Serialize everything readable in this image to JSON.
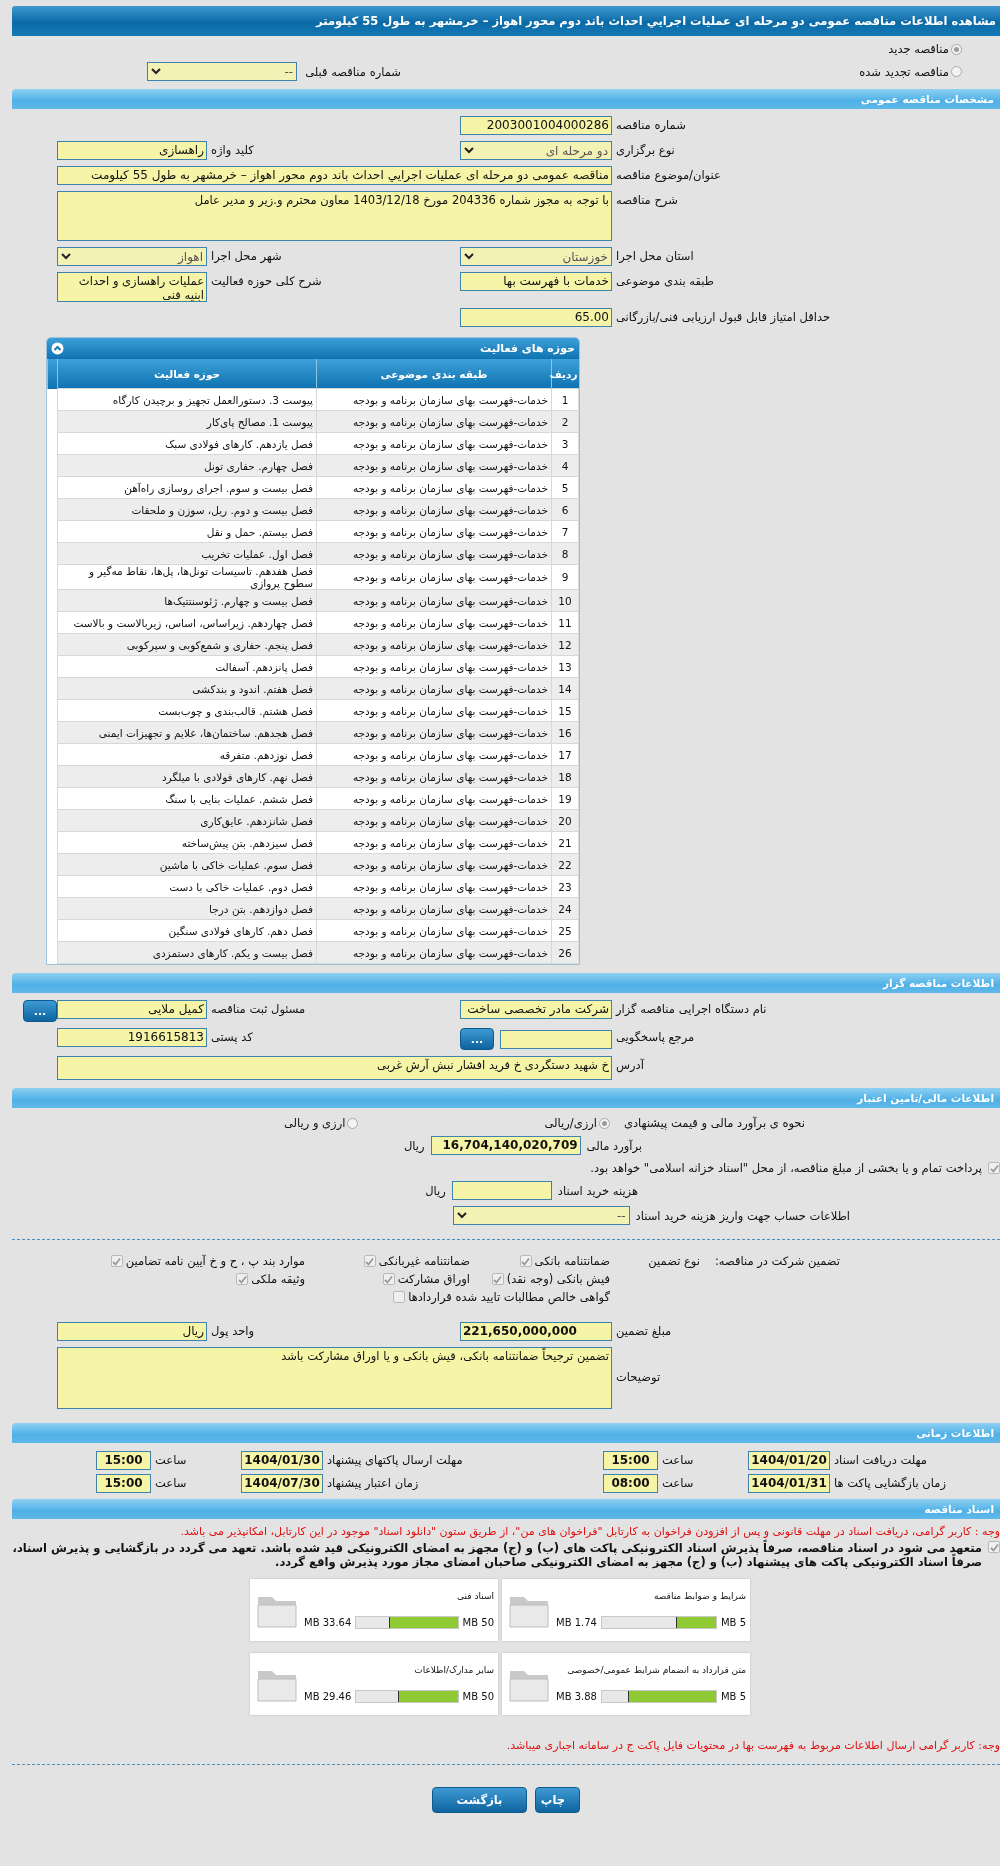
{
  "title": "مشاهده اطلاعات مناقصه عمومی دو مرحله ای عملیات اجرایي احداث باند دوم محور اهواز – خرمشهر به طول 55 کیلومتر",
  "tender_kind": [
    {
      "label": "مناقصه جدید",
      "selected": true
    },
    {
      "label": "مناقصه تجدید شده",
      "selected": false
    }
  ],
  "previous_tender": {
    "label": "شماره مناقصه قبلی",
    "value": "--"
  },
  "general": {
    "header": "مشخصات مناقصه عمومی",
    "rows": [
      {
        "right": {
          "label": "شماره مناقصه",
          "value": "2003001004000286",
          "kind": "text"
        }
      },
      {
        "right": {
          "label": "نوع برگزاری",
          "value": "دو مرحله ای",
          "kind": "select"
        },
        "left": {
          "label": "کلید واژه",
          "value": "راهسازی",
          "kind": "text"
        }
      },
      {
        "right": {
          "label": "عنوان/موضوع مناقصه",
          "value": "مناقصه عمومی دو مرحله ای عملیات اجرایي احداث باند دوم محور اهواز – خرمشهر به طول 55 کیلومت",
          "kind": "wide"
        }
      },
      {
        "right": {
          "label": "شرح مناقصه",
          "value": "با توجه به مجوز شماره 204336 مورخ 1403/12/18 معاون محترم و.زیر و مدیر عامل",
          "kind": "wide_textarea"
        }
      },
      {
        "right": {
          "label": "استان محل اجرا",
          "value": "خوزستان",
          "kind": "select"
        },
        "left": {
          "label": "شهر محل اجرا",
          "value": "اهواز",
          "kind": "select"
        }
      },
      {
        "right": {
          "label": "طبقه بندی موضوعی",
          "value": "خدمات با فهرست بها",
          "kind": "text"
        },
        "left": {
          "label": "شرح کلی حوزه فعالیت",
          "value": "عملیات راهسازی و احداث ابنیه فنی",
          "kind": "textarea"
        }
      },
      {
        "right": {
          "label": "حداقل امتیاز قابل قبول ارزیابی فنی/بازرگانی",
          "value": "65.00",
          "kind": "text"
        }
      }
    ]
  },
  "activities": {
    "header": "حوزه های فعالیت",
    "expanded": true,
    "columns": [
      "ردیف",
      "طبقه بندی موضوعی",
      "حوزه فعالیت"
    ],
    "rows": [
      {
        "n": "1",
        "category": "خدمات-فهرست بهای سازمان برنامه و بودجه",
        "area": "پیوست 3. دستورالعمل تجهیز و برچیدن کارگاه"
      },
      {
        "n": "2",
        "category": "خدمات-فهرست بهای سازمان برنامه و بودجه",
        "area": "پیوست 1. مصالح پای‌کار"
      },
      {
        "n": "3",
        "category": "خدمات-فهرست بهای سازمان برنامه و بودجه",
        "area": "فصل یازدهم. کارهای فولادی سبک"
      },
      {
        "n": "4",
        "category": "خدمات-فهرست بهای سازمان برنامه و بودجه",
        "area": "فصل چهارم. حفاری تونل"
      },
      {
        "n": "5",
        "category": "خدمات-فهرست بهای سازمان برنامه و بودجه",
        "area": "فصل بیست و سوم. اجرای روسازی راه‌آهن"
      },
      {
        "n": "6",
        "category": "خدمات-فهرست بهای سازمان برنامه و بودجه",
        "area": "فصل بیست و دوم. ریل، سوزن و ملحقات"
      },
      {
        "n": "7",
        "category": "خدمات-فهرست بهای سازمان برنامه و بودجه",
        "area": "فصل بیستم. حمل و نقل"
      },
      {
        "n": "8",
        "category": "خدمات-فهرست بهای سازمان برنامه و بودجه",
        "area": "فصل اول. عملیات تخریب"
      },
      {
        "n": "9",
        "category": "خدمات-فهرست بهای سازمان برنامه و بودجه",
        "area": "فصل هفدهم. تاسیسات تونل‌ها، پل‌ها، نقاط مه‌گیر و سطوح پروازی"
      },
      {
        "n": "10",
        "category": "خدمات-فهرست بهای سازمان برنامه و بودجه",
        "area": "فصل بیست و چهارم. ژئوسنتتیک‌ها"
      },
      {
        "n": "11",
        "category": "خدمات-فهرست بهای سازمان برنامه و بودجه",
        "area": "فصل چهاردهم. زیراساس، اساس، زیربالاست  و بالاست"
      },
      {
        "n": "12",
        "category": "خدمات-فهرست بهای سازمان برنامه و بودجه",
        "area": "فصل پنجم. حفاری و شمع‌کوبی و سپرکوبی"
      },
      {
        "n": "13",
        "category": "خدمات-فهرست بهای سازمان برنامه و بودجه",
        "area": "فصل پانزدهم. آسفالت"
      },
      {
        "n": "14",
        "category": "خدمات-فهرست بهای سازمان برنامه و بودجه",
        "area": "فصل هفتم. اندود و بندکشی"
      },
      {
        "n": "15",
        "category": "خدمات-فهرست بهای سازمان برنامه و بودجه",
        "area": "فصل هشتم. قالب‌بندی و چوب‌بست"
      },
      {
        "n": "16",
        "category": "خدمات-فهرست بهای سازمان برنامه و بودجه",
        "area": "فصل هجدهم. ساختمان‌ها، علایم و تجهیزات ایمنی"
      },
      {
        "n": "17",
        "category": "خدمات-فهرست بهای سازمان برنامه و بودجه",
        "area": "فصل نوزدهم. متفرقه"
      },
      {
        "n": "18",
        "category": "خدمات-فهرست بهای سازمان برنامه و بودجه",
        "area": "فصل نهم. کارهای فولادی با میلگرد"
      },
      {
        "n": "19",
        "category": "خدمات-فهرست بهای سازمان برنامه و بودجه",
        "area": "فصل ششم. عملیات بنایی با سنگ"
      },
      {
        "n": "20",
        "category": "خدمات-فهرست بهای سازمان برنامه و بودجه",
        "area": "فصل شانزدهم. عایق‌کاری"
      },
      {
        "n": "21",
        "category": "خدمات-فهرست بهای سازمان برنامه و بودجه",
        "area": "فصل سیزدهم. بتن پیش‌ساخته"
      },
      {
        "n": "22",
        "category": "خدمات-فهرست بهای سازمان برنامه و بودجه",
        "area": "فصل سوم. عملیات خاکی با ماشین"
      },
      {
        "n": "23",
        "category": "خدمات-فهرست بهای سازمان برنامه و بودجه",
        "area": "فصل دوم. عملیات خاکی با دست"
      },
      {
        "n": "24",
        "category": "خدمات-فهرست بهای سازمان برنامه و بودجه",
        "area": "فصل دوازدهم. بتن درجا"
      },
      {
        "n": "25",
        "category": "خدمات-فهرست بهای سازمان برنامه و بودجه",
        "area": "فصل دهم. کارهای فولادی سنگین"
      },
      {
        "n": "26",
        "category": "خدمات-فهرست بهای سازمان برنامه و بودجه",
        "area": "فصل بیست و یکم. کارهای دستمزدی"
      }
    ]
  },
  "organizer": {
    "header": "اطلاعات مناقصه گزار",
    "rows": [
      {
        "right": {
          "label": "نام دستگاه اجرایی مناقصه گزار",
          "value": "شرکت مادر تخصصی ساخت",
          "kind": "text"
        },
        "left": {
          "label": "مسئول ثبت مناقصه",
          "value": "کمیل ملایی",
          "kind": "text",
          "button": "..."
        }
      },
      {
        "right": {
          "label": "مرجع پاسخگویی",
          "kind": "text",
          "button": "..."
        },
        "left": {
          "label": "کد پستی",
          "value": "1916615813",
          "kind": "text"
        }
      },
      {
        "right": {
          "label": "آدرس",
          "value": "خ شهید دستگردی خ فرید افشار نبش آرش غربی",
          "kind": "wide_textarea"
        }
      }
    ]
  },
  "finance": {
    "header": "اطلاعات مالی/تامین اعتبار",
    "estimate_method": {
      "label": "نحوه ی برآورد مالی و قیمت پیشنهادی",
      "options": [
        {
          "label": "ارزی/ریالی",
          "selected": true
        },
        {
          "label": "ارزی و ریالی",
          "selected": false
        }
      ]
    },
    "estimate": {
      "label": "برآورد مالی",
      "value": "16,704,140,020,709",
      "unit": "ریال"
    },
    "treasury": {
      "label": "پرداخت تمام و یا بخشی از مبلغ مناقصه، از محل \"اسناد خزانه اسلامی\" خواهد بود.",
      "checked": true
    },
    "doc_fee": {
      "label": "هزینه خرید اسناد",
      "unit": "ریال"
    },
    "account": {
      "label": "اطلاعات حساب جهت واریز هزینه خرید اسناد",
      "value": "--"
    }
  },
  "guarantee": {
    "label": "تضمین شرکت در مناقصه:",
    "type_label": "نوع تضمین",
    "options": [
      {
        "label": "ضمانتنامه بانکی",
        "checked": true
      },
      {
        "label": "ضمانتنامه غیربانکی",
        "checked": true
      },
      {
        "label": "موارد بند پ ، ح و خ آیین نامه تضامین",
        "checked": true
      },
      {
        "label": "فیش بانکی (وجه نقد)",
        "checked": true
      },
      {
        "label": "اوراق مشارکت",
        "checked": true
      },
      {
        "label": "وثیقه ملکی",
        "checked": true
      },
      {
        "label": "گواهی خالص مطالبات تایید شده قراردادها",
        "checked": false
      }
    ],
    "amount": {
      "label": "مبلغ تضمین",
      "value": "221,650,000,000"
    },
    "currency": {
      "label": "واحد پول",
      "value": "ریال"
    },
    "notes": {
      "label": "توضیحات",
      "value": "تضمین ترجیحاً ضمانتنامه بانکی، فیش بانکی و یا اوراق مشارکت باشد"
    }
  },
  "timing": {
    "header": "اطلاعات زمانی",
    "rows": [
      [
        {
          "label": "مهلت دریافت اسناد",
          "value": "1404/01/20"
        },
        {
          "label": "ساعت",
          "value": "15:00"
        },
        {
          "label": "مهلت ارسال پاکتهای پیشنهاد",
          "value": "1404/01/30"
        },
        {
          "label": "ساعت",
          "value": "15:00"
        }
      ],
      [
        {
          "label": "زمان بازگشایی پاکت ها",
          "value": "1404/01/31"
        },
        {
          "label": "ساعت",
          "value": "08:00"
        },
        {
          "label": "زمان اعتبار پیشنهاد",
          "value": "1404/07/30"
        },
        {
          "label": "ساعت",
          "value": "15:00"
        }
      ]
    ]
  },
  "documents": {
    "header": "اسناد مناقصه",
    "notice": "وجه : کاربر گرامی، دریافت اسناد در مهلت قانونی و پس از افزودن فراخوان به کارتابل \"فراخوان های من\"، از طریق ستون \"دانلود اسناد\" موجود در این کارتابل، امکانپذیر می باشد.",
    "commitment": {
      "text": "متعهد می شود در اسناد مناقصه، صرفاً پذیرش اسناد الکترونیکی پاکت های (ب) و (ج) مجهز به امضای الکترونیکی قید شده باشد. تعهد می گردد در بازگشایی و پذیرش اسناد، صرفاً اسناد الکترونیکی پاکت های پیشنهاد (ب) و (ج) مجهز به امضای الکترونیکی صاحبان امضای مجاز مورد پذیرش واقع گردد.",
      "checked": true
    },
    "files": [
      {
        "name": "شرایط و ضوابط مناقصه",
        "max": "5 MB",
        "used": "1.74 MB",
        "level": 0.348
      },
      {
        "name": "اسناد فنی",
        "max": "50 MB",
        "used": "33.64 MB",
        "level": 0.673
      },
      {
        "name": "متن قرارداد به انضمام شرایط عمومی/خصوصی",
        "max": "5 MB",
        "used": "3.88 MB",
        "level": 0.776
      },
      {
        "name": "سایر مدارک/اطلاعات",
        "max": "50 MB",
        "used": "29.46 MB",
        "level": 0.589
      }
    ],
    "footer_notice": "وجه: کاربر گرامی ارسال اطلاعات مربوط به فهرست بها در محتویات فایل پاکت ج در سامانه اجباری میباشد."
  },
  "buttons": [
    {
      "label": "چاپ",
      "kind": "print"
    },
    {
      "label": "بازگشت",
      "kind": "back"
    }
  ]
}
